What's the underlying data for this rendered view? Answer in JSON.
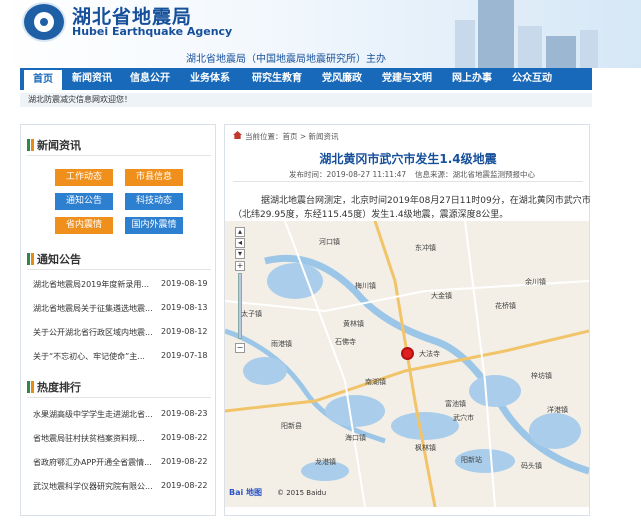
{
  "header": {
    "site_name_cn": "湖北省地震局",
    "site_name_en": "Hubei Earthquake Agency",
    "subtitle": "湖北省地震局（中国地震局地震研究所）主办"
  },
  "nav": {
    "items": [
      "首页",
      "新闻资讯",
      "信息公开",
      "业务体系",
      "研究生教育",
      "党风廉政",
      "党建与文明",
      "网上办事",
      "公众互动"
    ]
  },
  "notice": "湖北防震减灾信息网欢迎您！",
  "left": {
    "news": {
      "title": "新闻资讯",
      "buttons": [
        "工作动态",
        "市县信息",
        "通知公告",
        "科技动态",
        "省内震情",
        "国内外震情"
      ]
    },
    "announcements": {
      "title": "通知公告",
      "items": [
        {
          "text": "湖北省地震局2019年度新录用...",
          "date": "2019-08-19"
        },
        {
          "text": "湖北省地震局关于征集遴选地震...",
          "date": "2019-08-13"
        },
        {
          "text": "关于公开湖北省行政区域内地震...",
          "date": "2019-08-12"
        },
        {
          "text": "关于“不忘初心、牢记使命”主...",
          "date": "2019-07-18"
        }
      ]
    },
    "ranking": {
      "title": "热度排行",
      "items": [
        {
          "text": "水果湖高级中学学生走进湖北省...",
          "date": "2019-08-23"
        },
        {
          "text": "省地震局驻村扶贫档案资料规...",
          "date": "2019-08-22"
        },
        {
          "text": "省政府鄂汇办APP开通全省震情...",
          "date": "2019-08-22"
        },
        {
          "text": "武汉地震科学仪器研究院有限公...",
          "date": "2019-08-22"
        }
      ]
    }
  },
  "article": {
    "breadcrumb": "当前位置：首页 > 新闻资讯",
    "title": "湖北黄冈市武穴市发生1.4级地震",
    "publish_time": "发布时间：2019-08-27 11:11:47",
    "source": "信息来源：湖北省地震监测预报中心",
    "para1": "据湖北地震台网测定，北京时间2019年08月27日11时09分，在湖北黄冈市武穴市",
    "para2": "（北纬29.95度，东经115.45度）发生1.4级地震，震源深度8公里。"
  },
  "map": {
    "zoom_in": "+",
    "zoom_out": "−",
    "labels": [
      "河口镇",
      "东冲镇",
      "梅川镇",
      "大金镇",
      "黄林镇",
      "石佛寺",
      "太子镇",
      "雨港镇",
      "花桥镇",
      "大法寺",
      "南湖镇",
      "富池镇",
      "武穴市",
      "阳新县",
      "海口镇",
      "枫林镇",
      "龙港镇",
      "码头镇",
      "余川镇",
      "梓坊镇",
      "阳新站",
      "洋港镇"
    ],
    "baidu_logo": "Bai 地图",
    "copyright": "© 2015 Baidu"
  }
}
